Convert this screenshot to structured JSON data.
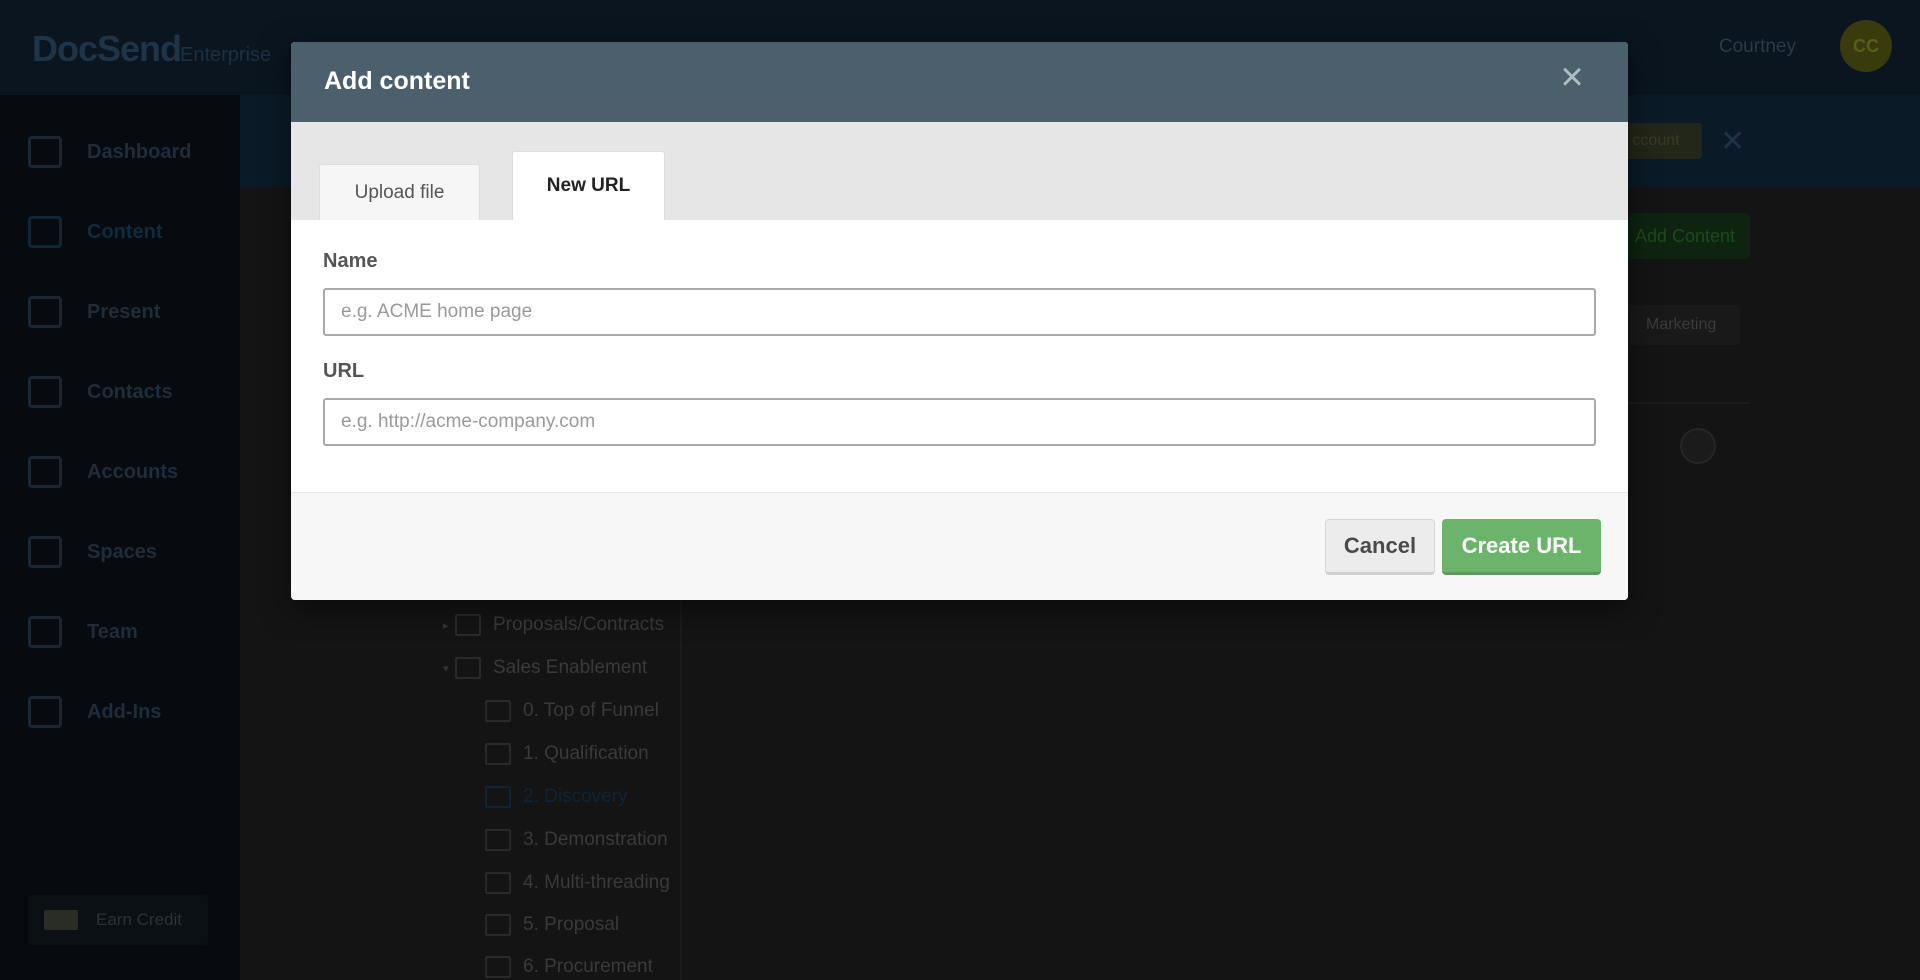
{
  "app": {
    "logo": "DocSend",
    "edition": "Enterprise",
    "user_name": "Courtney",
    "user_initials": "CC"
  },
  "sidebar": {
    "items": [
      {
        "label": "Dashboard",
        "icon": "dashboard-icon"
      },
      {
        "label": "Content",
        "icon": "content-icon",
        "active": true
      },
      {
        "label": "Present",
        "icon": "present-icon"
      },
      {
        "label": "Contacts",
        "icon": "contacts-icon"
      },
      {
        "label": "Accounts",
        "icon": "accounts-icon"
      },
      {
        "label": "Spaces",
        "icon": "spaces-icon"
      },
      {
        "label": "Team",
        "icon": "team-icon"
      },
      {
        "label": "Add-Ins",
        "icon": "add-ins-icon"
      }
    ],
    "earn_credit": "Earn Credit"
  },
  "background": {
    "banner_button": "ccount",
    "add_content_button": "Add Content",
    "tag": "Marketing",
    "folders": [
      {
        "label": "Proposals/Contracts",
        "level": 0,
        "caret": "▸"
      },
      {
        "label": "Sales Enablement",
        "level": 0,
        "caret": "▾"
      },
      {
        "label": "0. Top of Funnel",
        "level": 1
      },
      {
        "label": "1. Qualification",
        "level": 1
      },
      {
        "label": "2. Discovery",
        "level": 1,
        "selected": true
      },
      {
        "label": "3. Demonstration",
        "level": 1
      },
      {
        "label": "4. Multi-threading",
        "level": 1
      },
      {
        "label": "5. Proposal",
        "level": 1
      },
      {
        "label": "6. Procurement",
        "level": 1
      }
    ]
  },
  "modal": {
    "title": "Add content",
    "close_icon": "×",
    "tabs": [
      {
        "label": "Upload file",
        "active": false
      },
      {
        "label": "New URL",
        "active": true
      }
    ],
    "name_field": {
      "label": "Name",
      "value": "",
      "placeholder": "e.g. ACME home page"
    },
    "url_field": {
      "label": "URL",
      "value": "",
      "placeholder": "e.g. http://acme-company.com"
    },
    "cancel_label": "Cancel",
    "create_label": "Create URL"
  },
  "colors": {
    "modal_header": "#4b5f6c",
    "create_button": "#6cb36c",
    "active_nav": "#0f2b3f"
  }
}
